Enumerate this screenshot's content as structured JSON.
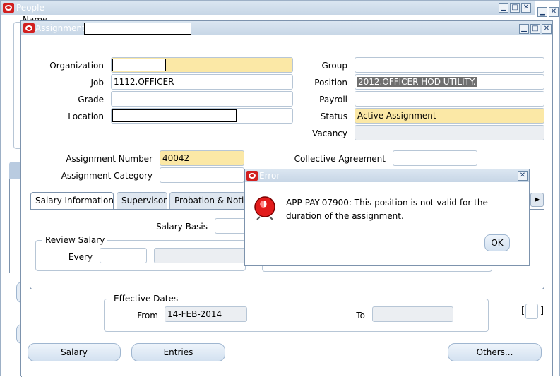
{
  "people_window": {
    "title": "People",
    "behind_label": "Name"
  },
  "assignment_window": {
    "title": "Assignment"
  },
  "fields": {
    "organization": {
      "label": "Organization",
      "value": ""
    },
    "job": {
      "label": "Job",
      "value": "1112.OFFICER"
    },
    "grade": {
      "label": "Grade",
      "value": ""
    },
    "location": {
      "label": "Location",
      "value": ""
    },
    "group": {
      "label": "Group",
      "value": ""
    },
    "position": {
      "label": "Position",
      "value": "2012.OFFICER HOD UTILITY."
    },
    "payroll": {
      "label": "Payroll",
      "value": ""
    },
    "status": {
      "label": "Status",
      "value": "Active Assignment"
    },
    "vacancy": {
      "label": "Vacancy",
      "value": ""
    },
    "assignment_number": {
      "label": "Assignment Number",
      "value": "40042"
    },
    "collective_agreement": {
      "label": "Collective Agreement",
      "value": ""
    },
    "assignment_category": {
      "label": "Assignment Category",
      "value": ""
    }
  },
  "tabs": [
    {
      "label": "Salary Information"
    },
    {
      "label": "Supervisor"
    },
    {
      "label": "Probation & Notic"
    }
  ],
  "salary_info": {
    "salary_basis_label": "Salary Basis",
    "review_salary_label": "Review Salary",
    "every_label": "Every"
  },
  "effective_dates": {
    "title": "Effective Dates",
    "from_label": "From",
    "from_value": "14-FEB-2014",
    "to_label": "To",
    "to_value": ""
  },
  "bracket_field": "[ ]",
  "buttons": {
    "salary": "Salary",
    "entries": "Entries",
    "others": "Others..."
  },
  "error_dialog": {
    "title": "Error",
    "message": "APP-PAY-07900: This position is not valid for the duration of the assignment.",
    "ok_label": "OK"
  },
  "colors": {
    "required_field": "#fbe8a6",
    "window_border": "#7d93ad",
    "titlebar": "#c7d6e6"
  }
}
